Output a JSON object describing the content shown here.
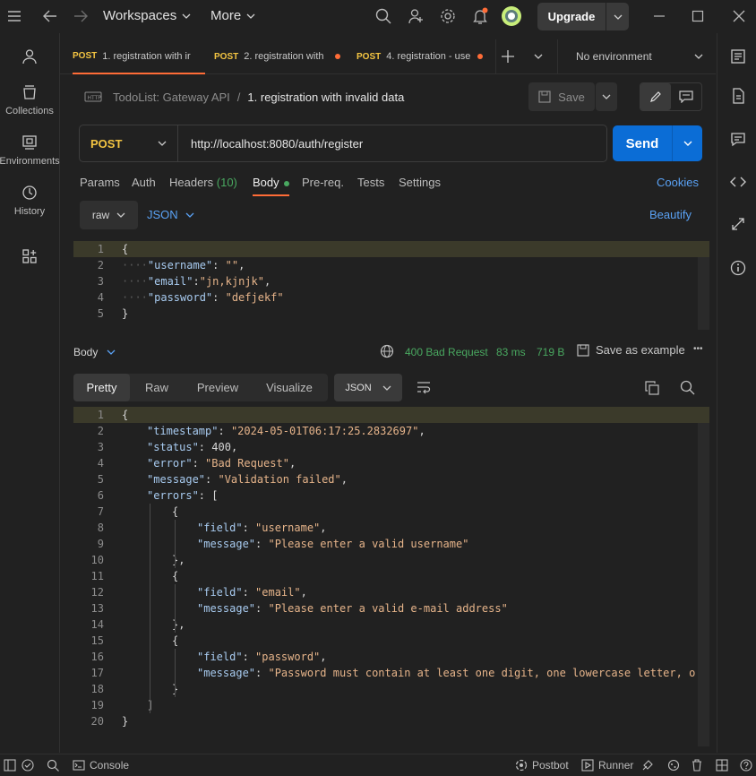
{
  "topbar": {
    "workspaces": "Workspaces",
    "more": "More",
    "upgrade": "Upgrade"
  },
  "sidebar": {
    "items": [
      {
        "label": "Collections",
        "icon": "collections-icon"
      },
      {
        "label": "Environments",
        "icon": "environments-icon"
      },
      {
        "label": "History",
        "icon": "history-icon"
      }
    ]
  },
  "tabs": [
    {
      "method": "POST",
      "label": "1. registration with ir",
      "active": true
    },
    {
      "method": "POST",
      "label": "2. registration with",
      "unsaved": true
    },
    {
      "method": "POST",
      "label": "4. registration - use",
      "unsaved": true
    }
  ],
  "environment": "No environment",
  "breadcrumb": {
    "collection": "TodoList: Gateway API",
    "separator": "/",
    "request": "1. registration with invalid data"
  },
  "save_label": "Save",
  "request": {
    "method": "POST",
    "url": "http://localhost:8080/auth/register",
    "send": "Send"
  },
  "request_tabs": {
    "params": "Params",
    "auth": "Auth",
    "headers": "Headers",
    "headers_count": "(10)",
    "body": "Body",
    "prereq": "Pre-req.",
    "tests": "Tests",
    "settings": "Settings",
    "cookies": "Cookies"
  },
  "body_options": {
    "mode": "raw",
    "language": "JSON",
    "beautify": "Beautify"
  },
  "request_body": {
    "line_numbers": [
      "1",
      "2",
      "3",
      "4",
      "5"
    ],
    "brace_open": "{",
    "brace_close": "}",
    "fields": [
      {
        "key": "\"username\"",
        "sep": ": ",
        "value": "\"\"",
        "end": ","
      },
      {
        "key": "\"email\"",
        "sep": ":",
        "value": "\"jn,kjnjk\"",
        "end": ","
      },
      {
        "key": "\"password\"",
        "sep": ": ",
        "value": "\"defjekf\"",
        "end": ""
      }
    ]
  },
  "response": {
    "body_label": "Body",
    "status": "400 Bad Request",
    "time": "83 ms",
    "size": "719 B",
    "save_example": "Save as example",
    "more": "•••",
    "view_tabs": [
      "Pretty",
      "Raw",
      "Preview",
      "Visualize"
    ],
    "format": "JSON",
    "line_numbers": [
      "1",
      "2",
      "3",
      "4",
      "5",
      "6",
      "7",
      "8",
      "9",
      "10",
      "11",
      "12",
      "13",
      "14",
      "15",
      "16",
      "17",
      "18",
      "19",
      "20"
    ],
    "lines": [
      {
        "indent": 0,
        "parts": [
          [
            "p",
            "{"
          ]
        ]
      },
      {
        "indent": 1,
        "parts": [
          [
            "k",
            "\"timestamp\""
          ],
          [
            "p",
            ": "
          ],
          [
            "s",
            "\"2024-05-01T06:17:25.2832697\""
          ],
          [
            "p",
            ","
          ]
        ]
      },
      {
        "indent": 1,
        "parts": [
          [
            "k",
            "\"status\""
          ],
          [
            "p",
            ": "
          ],
          [
            "n",
            "400"
          ],
          [
            "p",
            ","
          ]
        ]
      },
      {
        "indent": 1,
        "parts": [
          [
            "k",
            "\"error\""
          ],
          [
            "p",
            ": "
          ],
          [
            "s",
            "\"Bad Request\""
          ],
          [
            "p",
            ","
          ]
        ]
      },
      {
        "indent": 1,
        "parts": [
          [
            "k",
            "\"message\""
          ],
          [
            "p",
            ": "
          ],
          [
            "s",
            "\"Validation failed\""
          ],
          [
            "p",
            ","
          ]
        ]
      },
      {
        "indent": 1,
        "parts": [
          [
            "k",
            "\"errors\""
          ],
          [
            "p",
            ": ["
          ]
        ]
      },
      {
        "indent": 2,
        "parts": [
          [
            "p",
            "{"
          ]
        ]
      },
      {
        "indent": 3,
        "parts": [
          [
            "k",
            "\"field\""
          ],
          [
            "p",
            ": "
          ],
          [
            "s",
            "\"username\""
          ],
          [
            "p",
            ","
          ]
        ]
      },
      {
        "indent": 3,
        "parts": [
          [
            "k",
            "\"message\""
          ],
          [
            "p",
            ": "
          ],
          [
            "s",
            "\"Please enter a valid username\""
          ]
        ]
      },
      {
        "indent": 2,
        "parts": [
          [
            "p",
            "},"
          ]
        ]
      },
      {
        "indent": 2,
        "parts": [
          [
            "p",
            "{"
          ]
        ]
      },
      {
        "indent": 3,
        "parts": [
          [
            "k",
            "\"field\""
          ],
          [
            "p",
            ": "
          ],
          [
            "s",
            "\"email\""
          ],
          [
            "p",
            ","
          ]
        ]
      },
      {
        "indent": 3,
        "parts": [
          [
            "k",
            "\"message\""
          ],
          [
            "p",
            ": "
          ],
          [
            "s",
            "\"Please enter a valid e-mail address\""
          ]
        ]
      },
      {
        "indent": 2,
        "parts": [
          [
            "p",
            "},"
          ]
        ]
      },
      {
        "indent": 2,
        "parts": [
          [
            "p",
            "{"
          ]
        ]
      },
      {
        "indent": 3,
        "parts": [
          [
            "k",
            "\"field\""
          ],
          [
            "p",
            ": "
          ],
          [
            "s",
            "\"password\""
          ],
          [
            "p",
            ","
          ]
        ]
      },
      {
        "indent": 3,
        "parts": [
          [
            "k",
            "\"message\""
          ],
          [
            "p",
            ": "
          ],
          [
            "s",
            "\"Password must contain at least one digit, one lowercase letter, one up"
          ]
        ]
      },
      {
        "indent": 2,
        "parts": [
          [
            "p",
            "}"
          ]
        ]
      },
      {
        "indent": 1,
        "parts": [
          [
            "p",
            "]"
          ]
        ]
      },
      {
        "indent": 0,
        "parts": [
          [
            "p",
            "}"
          ]
        ]
      }
    ]
  },
  "statusbar": {
    "console": "Console",
    "postbot": "Postbot",
    "runner": "Runner"
  },
  "colors": {
    "accent": "#ff6c37",
    "send": "#0b6dd6",
    "method": "#f4c542",
    "status_ok": "#49a860"
  }
}
